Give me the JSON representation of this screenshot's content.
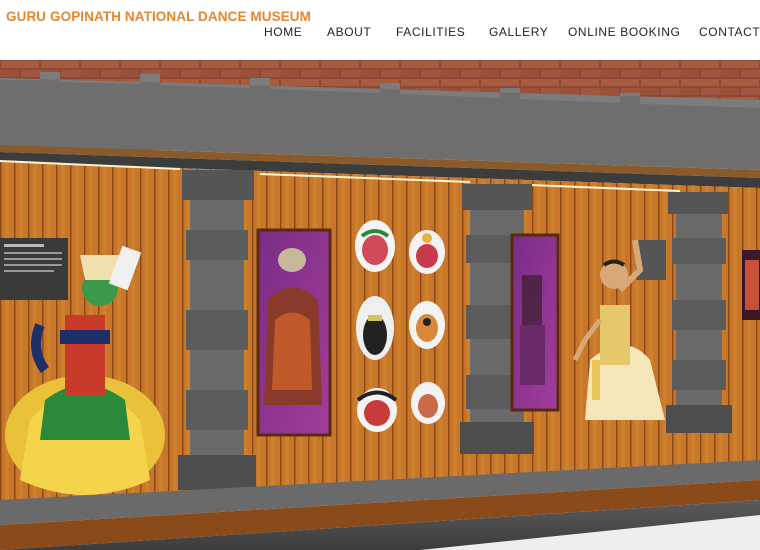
{
  "site": {
    "title": "GURU GOPINATH NATIONAL DANCE MUSEUM",
    "brand_color": "#e8852f"
  },
  "nav": {
    "items": [
      {
        "label": "HOME"
      },
      {
        "label": "ABOUT"
      },
      {
        "label": "FACILITIES"
      },
      {
        "label": "GALLERY"
      },
      {
        "label": "ONLINE BOOKING"
      },
      {
        "label": "CONTACT"
      }
    ]
  },
  "hero": {
    "image": "museum-interior-gallery",
    "colors": {
      "wood": "#c9782a",
      "brick": "#a3533a",
      "stone": "#6d6d6d",
      "purple": "#8a2e8a"
    }
  }
}
